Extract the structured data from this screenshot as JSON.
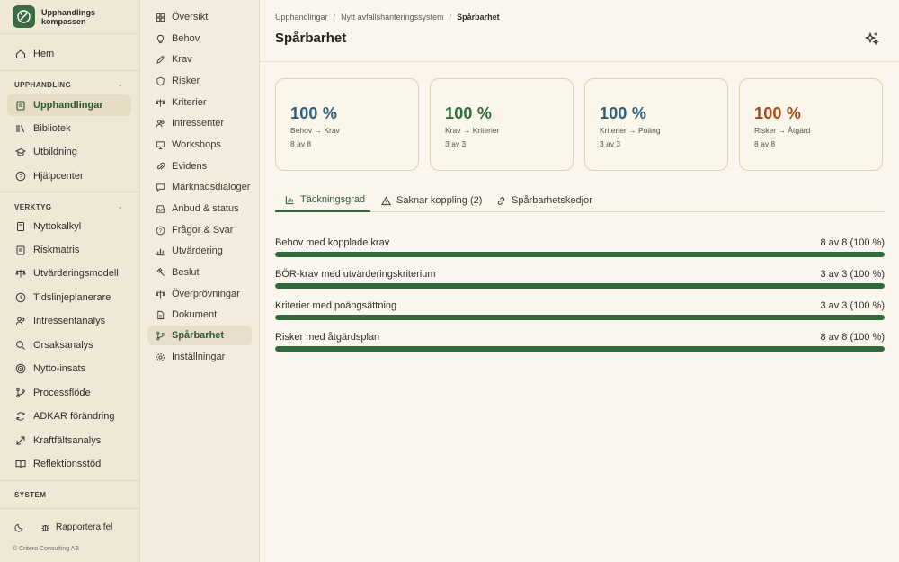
{
  "app": {
    "name_line1": "Upphandlings",
    "name_line2": "kompassen"
  },
  "left_nav": {
    "home": "Hem",
    "section_procurement": "UPPHANDLING",
    "procurement_items": [
      "Upphandlingar",
      "Bibliotek",
      "Utbildning",
      "Hjälpcenter"
    ],
    "section_tools": "VERKTYG",
    "tool_items": [
      "Nyttokalkyl",
      "Riskmatris",
      "Utvärderingsmodell",
      "Tidslinjeplanerare",
      "Intressentanalys",
      "Orsaksanalys",
      "Nytto-insats",
      "Processflöde",
      "ADKAR förändring",
      "Kraftfältsanalys",
      "Reflektionsstöd"
    ],
    "section_system": "SYSTEM",
    "report_bug": "Rapportera fel",
    "copyright": "© Critero Consulting AB"
  },
  "sub_nav": {
    "items": [
      "Översikt",
      "Behov",
      "Krav",
      "Risker",
      "Kriterier",
      "Intressenter",
      "Workshops",
      "Evidens",
      "Marknadsdialoger",
      "Anbud & status",
      "Frågor & Svar",
      "Utvärdering",
      "Beslut",
      "Överprövningar",
      "Dokument",
      "Spårbarhet",
      "Inställningar"
    ],
    "active": "Spårbarhet"
  },
  "breadcrumb": [
    "Upphandlingar",
    "Nytt avfallshanteringssystem",
    "Spårbarhet"
  ],
  "page_title": "Spårbarhet",
  "cards": [
    {
      "pct": "100 %",
      "label": "Behov → Krav",
      "count": "8 av 8",
      "color": "#2d5f7c"
    },
    {
      "pct": "100 %",
      "label": "Krav → Kriterier",
      "count": "3 av 3",
      "color": "#2f6a3a"
    },
    {
      "pct": "100 %",
      "label": "Kriterier → Poäng",
      "count": "3 av 3",
      "color": "#2d5f7c"
    },
    {
      "pct": "100 %",
      "label": "Risker → Åtgärd",
      "count": "8 av 8",
      "color": "#a24a18"
    }
  ],
  "tabs": [
    "Täckningsgrad",
    "Saknar koppling (2)",
    "Spårbarhetskedjor"
  ],
  "coverage": [
    {
      "label": "Behov med kopplade krav",
      "value": "8 av 8 (100 %)",
      "fraction": 1.0
    },
    {
      "label": "BÖR-krav med utvärderingskriterium",
      "value": "3 av 3 (100 %)",
      "fraction": 1.0
    },
    {
      "label": "Kriterier med poängsättning",
      "value": "3 av 3 (100 %)",
      "fraction": 1.0
    },
    {
      "label": "Risker med åtgärdsplan",
      "value": "8 av 8 (100 %)",
      "fraction": 1.0
    }
  ]
}
